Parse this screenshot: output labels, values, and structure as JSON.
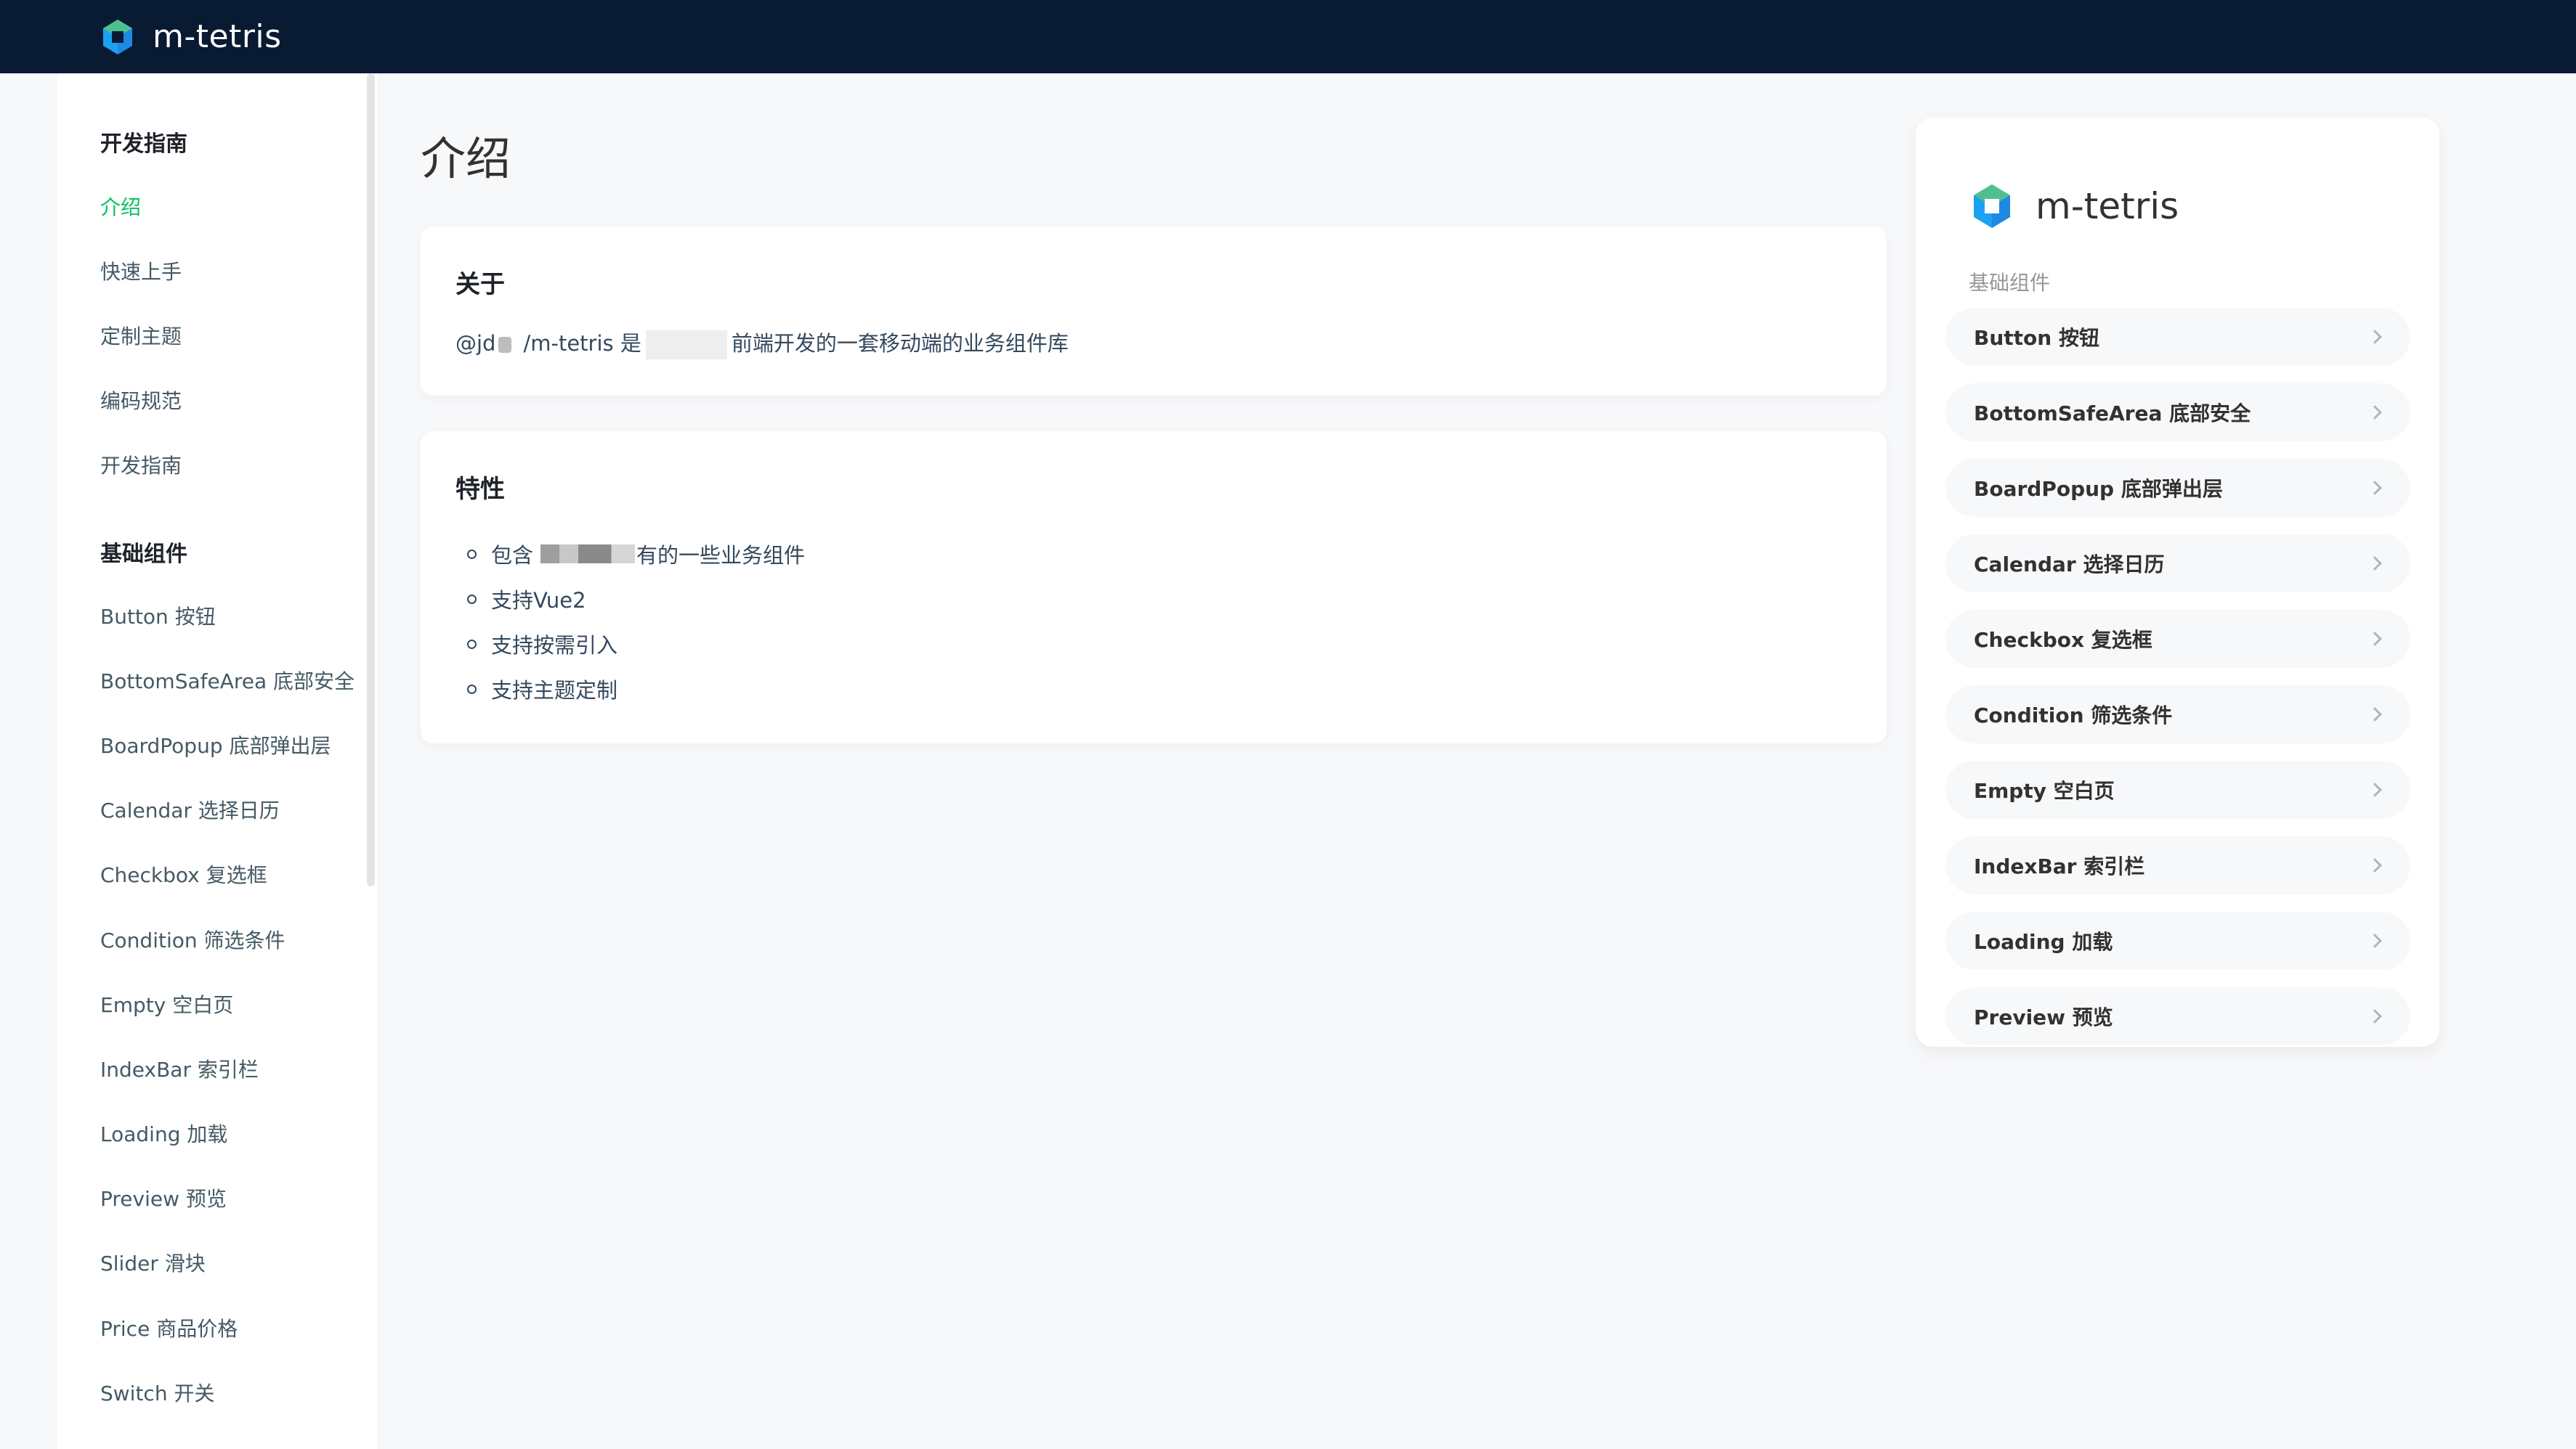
{
  "app": {
    "name": "m-tetris",
    "accent": "#07c160",
    "topbar_bg": "#091a33"
  },
  "sidebar": {
    "groups": [
      {
        "title": "开发指南",
        "items": [
          "介绍",
          "快速上手",
          "定制主题",
          "编码规范",
          "开发指南"
        ]
      },
      {
        "title": "基础组件",
        "items": [
          "Button 按钮",
          "BottomSafeArea 底部安全",
          "BoardPopup 底部弹出层",
          "Calendar 选择日历",
          "Checkbox 复选框",
          "Condition 筛选条件",
          "Empty 空白页",
          "IndexBar 索引栏",
          "Loading 加载",
          "Preview 预览",
          "Slider 滑块",
          "Price 商品价格",
          "Switch 开关"
        ]
      }
    ],
    "active_item": "介绍"
  },
  "main": {
    "page_title": "介绍",
    "about": {
      "title": "关于",
      "text_prefix": "@jd",
      "text_middle": "/m-tetris 是",
      "text_suffix": "前端开发的一套移动端的业务组件库"
    },
    "features": {
      "title": "特性",
      "items": [
        {
          "prefix": "包含",
          "suffix": "有的一些业务组件"
        },
        {
          "prefix": "支持Vue2",
          "suffix": ""
        },
        {
          "prefix": "支持按需引入",
          "suffix": ""
        },
        {
          "prefix": "支持主题定制",
          "suffix": ""
        }
      ]
    }
  },
  "preview": {
    "brand": "m-tetris",
    "section_title": "基础组件",
    "items": [
      "Button 按钮",
      "BottomSafeArea 底部安全",
      "BoardPopup 底部弹出层",
      "Calendar 选择日历",
      "Checkbox 复选框",
      "Condition 筛选条件",
      "Empty 空白页",
      "IndexBar 索引栏",
      "Loading 加载",
      "Preview 预览"
    ]
  }
}
